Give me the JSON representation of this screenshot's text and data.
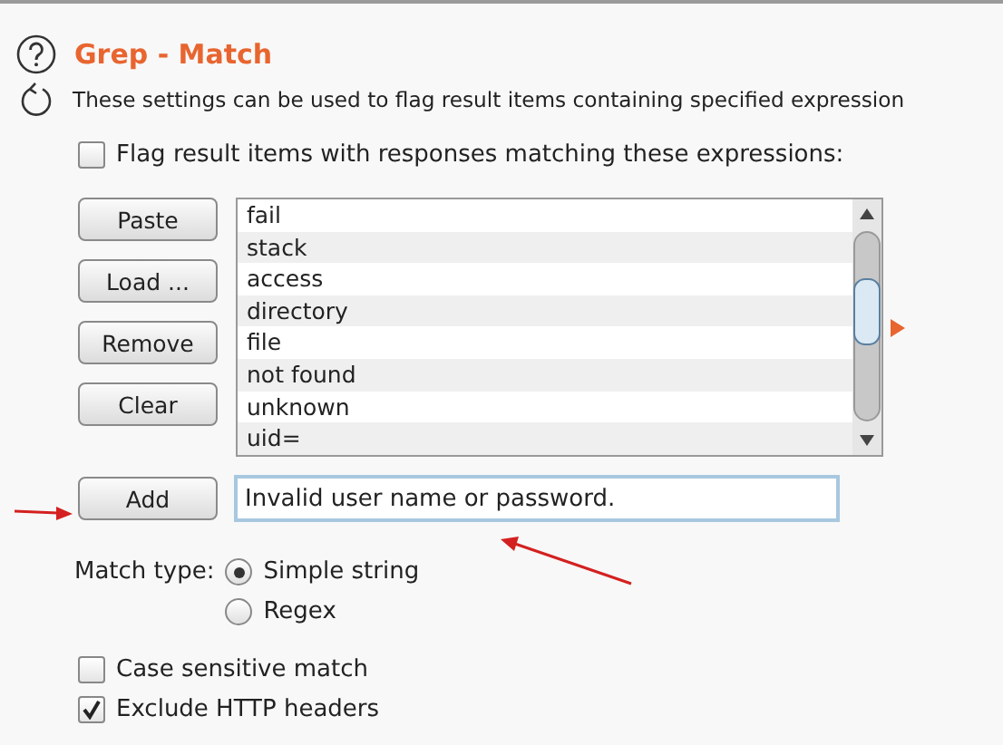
{
  "title": "Grep - Match",
  "description": "These settings can be used to flag result items containing specified expression",
  "flag_checkbox": {
    "label": "Flag result items with responses matching these expressions:",
    "checked": false
  },
  "buttons": [
    "Paste",
    "Load ...",
    "Remove",
    "Clear"
  ],
  "expressions": [
    "fail",
    "stack",
    "access",
    "directory",
    "file",
    "not found",
    "unknown",
    "uid="
  ],
  "add_button": "Add",
  "input": {
    "value": "Invalid user name or password."
  },
  "match_type": {
    "label": "Match type:",
    "options": [
      {
        "label": "Simple string",
        "selected": true
      },
      {
        "label": "Regex",
        "selected": false
      }
    ]
  },
  "options": [
    {
      "label": "Case sensitive match",
      "checked": false
    },
    {
      "label": "Exclude HTTP headers",
      "checked": true
    }
  ]
}
